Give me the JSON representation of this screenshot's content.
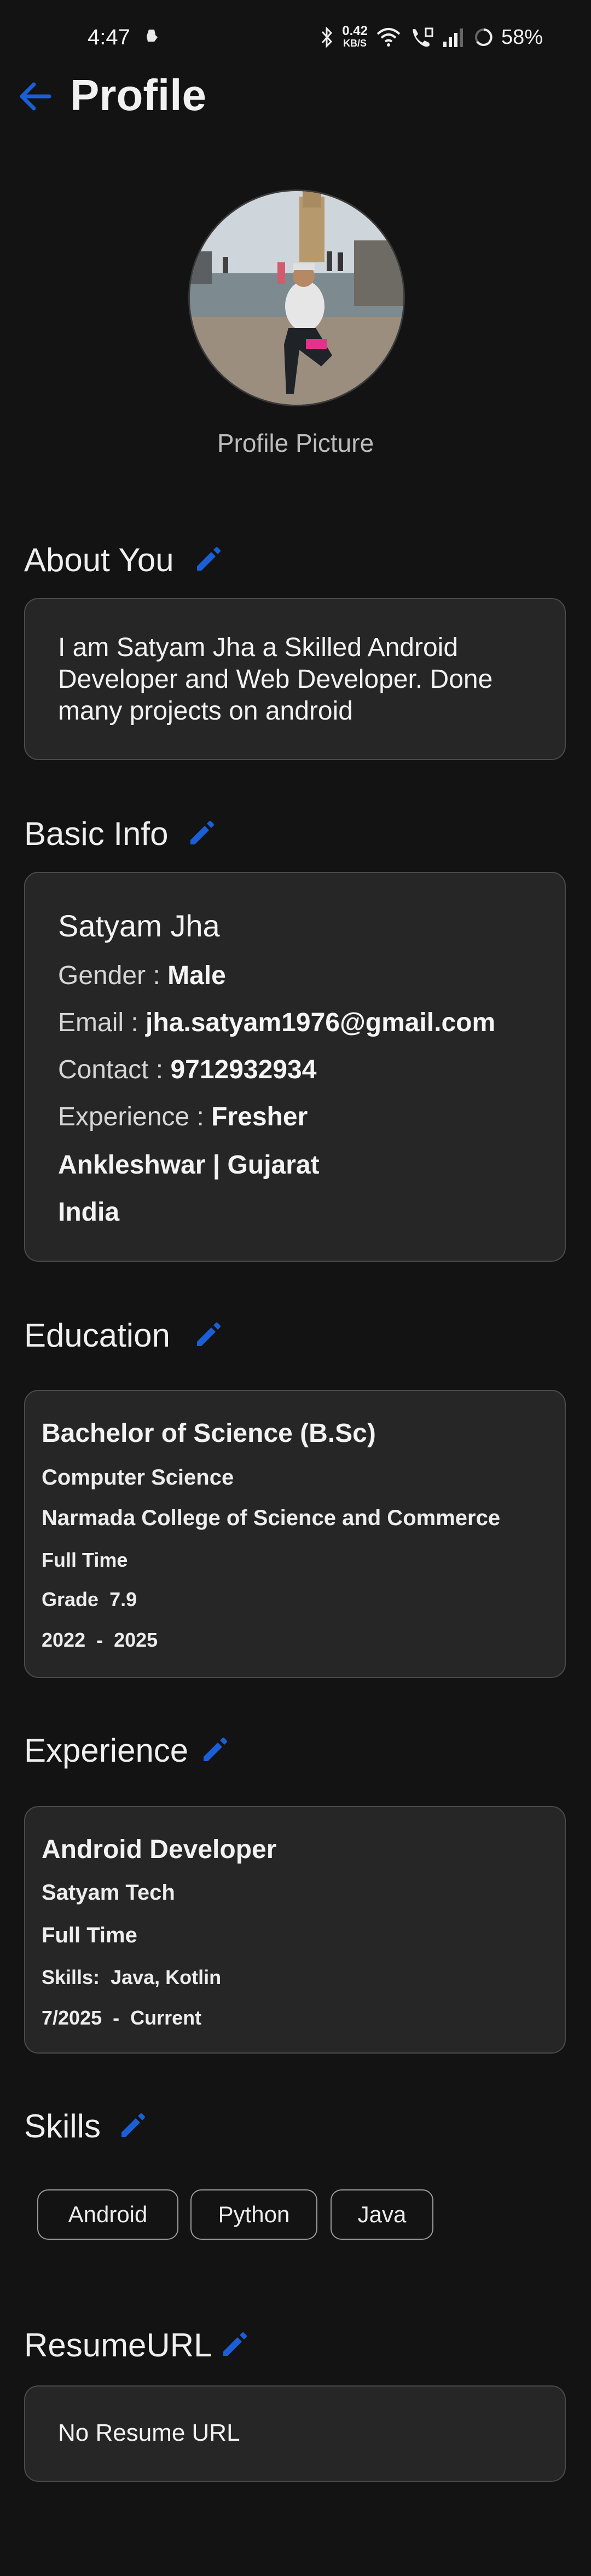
{
  "status_bar": {
    "time": "4:47",
    "net_speed_value": "0.42",
    "net_speed_unit": "KB/S",
    "battery": "58%"
  },
  "header": {
    "title": "Profile"
  },
  "profile_picture": {
    "caption": "Profile Picture"
  },
  "about": {
    "title": "About You",
    "text": "I am Satyam Jha a Skilled Android Developer and Web Developer. Done many projects on android"
  },
  "basic_info": {
    "title": "Basic Info",
    "name": "Satyam Jha",
    "gender_label": "Gender :",
    "gender": "Male",
    "email_label": "Email :",
    "email": "jha.satyam1976@gmail.com",
    "contact_label": "Contact :",
    "contact": "9712932934",
    "experience_label": "Experience :",
    "experience": "Fresher",
    "location": "Ankleshwar | Gujarat",
    "country": "India"
  },
  "education": {
    "title": "Education",
    "degree": "Bachelor of Science (B.Sc)",
    "field": "Computer Science",
    "college": "Narmada College of Science and Commerce",
    "type": "Full Time",
    "grade_label": "Grade",
    "grade": "7.9",
    "start": "2022",
    "end": "2025"
  },
  "experience": {
    "title": "Experience",
    "role": "Android Developer",
    "company": "Satyam Tech",
    "type": "Full Time",
    "skills_label": "Skills:",
    "skills": "Java, Kotlin",
    "start": "7/2025",
    "end": "Current"
  },
  "skills": {
    "title": "Skills",
    "items": [
      "Android",
      "Python",
      "Java"
    ]
  },
  "resume": {
    "title": "ResumeURL",
    "text": "No Resume URL"
  },
  "colors": {
    "background": "#131313",
    "card": "#262626",
    "accent": "#1a5fd6"
  }
}
